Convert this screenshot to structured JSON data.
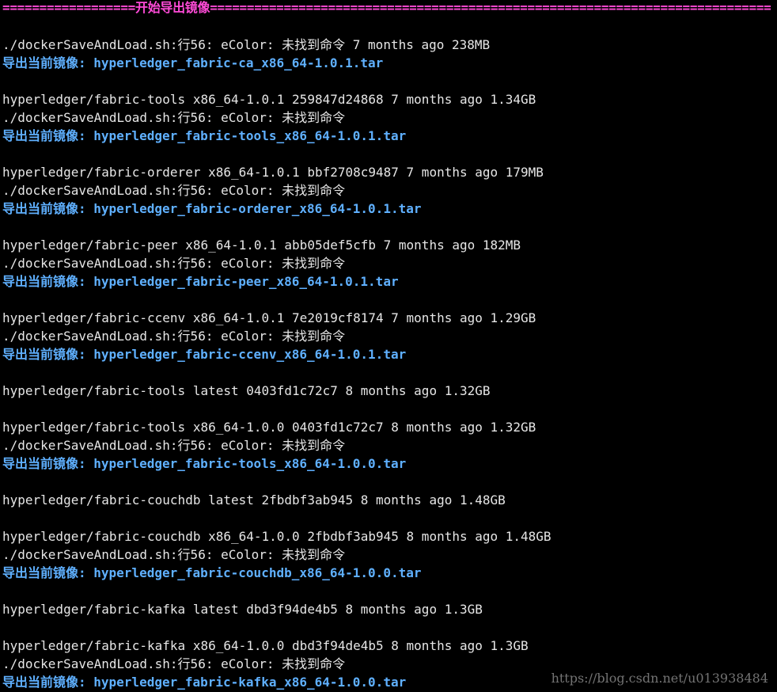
{
  "colors": {
    "background": "#000000",
    "text": "#e6e6e6",
    "banner": "#ff4bd8",
    "export": "#5fb0ff",
    "watermark": "#9a9a9a"
  },
  "banner": "==================开始导出镜像============================================================================",
  "lines": [
    {
      "kind": "blank",
      "text": ""
    },
    {
      "kind": "warn",
      "text": "./dockerSaveAndLoad.sh:行56: eColor: 未找到命令 7 months ago 238MB"
    },
    {
      "kind": "export",
      "text": "导出当前镜像: hyperledger_fabric-ca_x86_64-1.0.1.tar"
    },
    {
      "kind": "blank",
      "text": ""
    },
    {
      "kind": "plain",
      "text": "hyperledger/fabric-tools x86_64-1.0.1 259847d24868 7 months ago 1.34GB"
    },
    {
      "kind": "warn",
      "text": "./dockerSaveAndLoad.sh:行56: eColor: 未找到命令"
    },
    {
      "kind": "export",
      "text": "导出当前镜像: hyperledger_fabric-tools_x86_64-1.0.1.tar"
    },
    {
      "kind": "blank",
      "text": ""
    },
    {
      "kind": "plain",
      "text": "hyperledger/fabric-orderer x86_64-1.0.1 bbf2708c9487 7 months ago 179MB"
    },
    {
      "kind": "warn",
      "text": "./dockerSaveAndLoad.sh:行56: eColor: 未找到命令"
    },
    {
      "kind": "export",
      "text": "导出当前镜像: hyperledger_fabric-orderer_x86_64-1.0.1.tar"
    },
    {
      "kind": "blank",
      "text": ""
    },
    {
      "kind": "plain",
      "text": "hyperledger/fabric-peer x86_64-1.0.1 abb05def5cfb 7 months ago 182MB"
    },
    {
      "kind": "warn",
      "text": "./dockerSaveAndLoad.sh:行56: eColor: 未找到命令"
    },
    {
      "kind": "export",
      "text": "导出当前镜像: hyperledger_fabric-peer_x86_64-1.0.1.tar"
    },
    {
      "kind": "blank",
      "text": ""
    },
    {
      "kind": "plain",
      "text": "hyperledger/fabric-ccenv x86_64-1.0.1 7e2019cf8174 7 months ago 1.29GB"
    },
    {
      "kind": "warn",
      "text": "./dockerSaveAndLoad.sh:行56: eColor: 未找到命令"
    },
    {
      "kind": "export",
      "text": "导出当前镜像: hyperledger_fabric-ccenv_x86_64-1.0.1.tar"
    },
    {
      "kind": "blank",
      "text": ""
    },
    {
      "kind": "plain",
      "text": "hyperledger/fabric-tools latest 0403fd1c72c7 8 months ago 1.32GB"
    },
    {
      "kind": "blank",
      "text": ""
    },
    {
      "kind": "plain",
      "text": "hyperledger/fabric-tools x86_64-1.0.0 0403fd1c72c7 8 months ago 1.32GB"
    },
    {
      "kind": "warn",
      "text": "./dockerSaveAndLoad.sh:行56: eColor: 未找到命令"
    },
    {
      "kind": "export",
      "text": "导出当前镜像: hyperledger_fabric-tools_x86_64-1.0.0.tar"
    },
    {
      "kind": "blank",
      "text": ""
    },
    {
      "kind": "plain",
      "text": "hyperledger/fabric-couchdb latest 2fbdbf3ab945 8 months ago 1.48GB"
    },
    {
      "kind": "blank",
      "text": ""
    },
    {
      "kind": "plain",
      "text": "hyperledger/fabric-couchdb x86_64-1.0.0 2fbdbf3ab945 8 months ago 1.48GB"
    },
    {
      "kind": "warn",
      "text": "./dockerSaveAndLoad.sh:行56: eColor: 未找到命令"
    },
    {
      "kind": "export",
      "text": "导出当前镜像: hyperledger_fabric-couchdb_x86_64-1.0.0.tar"
    },
    {
      "kind": "blank",
      "text": ""
    },
    {
      "kind": "plain",
      "text": "hyperledger/fabric-kafka latest dbd3f94de4b5 8 months ago 1.3GB"
    },
    {
      "kind": "blank",
      "text": ""
    },
    {
      "kind": "plain",
      "text": "hyperledger/fabric-kafka x86_64-1.0.0 dbd3f94de4b5 8 months ago 1.3GB"
    },
    {
      "kind": "warn",
      "text": "./dockerSaveAndLoad.sh:行56: eColor: 未找到命令"
    },
    {
      "kind": "export",
      "text": "导出当前镜像: hyperledger_fabric-kafka_x86_64-1.0.0.tar"
    }
  ],
  "watermark": "https://blog.csdn.net/u013938484"
}
